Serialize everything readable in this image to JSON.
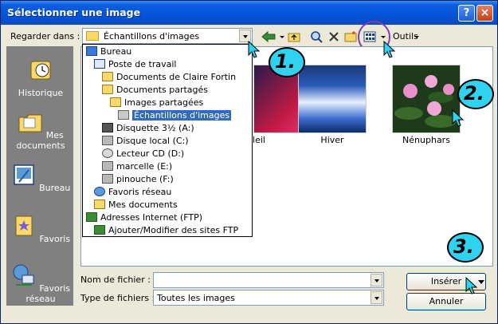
{
  "window": {
    "title": "Sélectionner une image",
    "help_label": "?",
    "close_label": "×"
  },
  "toolbar": {
    "look_in_label": "Regarder dans :",
    "look_in_value": "Échantillons d'images",
    "views_label": "Outils"
  },
  "places": [
    {
      "label": "Historique",
      "icon": "history-icon"
    },
    {
      "label": "Mes documents",
      "icon": "my-documents-icon"
    },
    {
      "label": "Bureau",
      "icon": "desktop-icon"
    },
    {
      "label": "Favoris",
      "icon": "favorites-icon"
    },
    {
      "label": "Favoris réseau",
      "icon": "network-places-icon"
    }
  ],
  "dropdown": {
    "items": [
      {
        "label": "Bureau",
        "icon": "desktop-icon",
        "indent": 0
      },
      {
        "label": "Poste de travail",
        "icon": "computer-icon",
        "indent": 1
      },
      {
        "label": "Documents de Claire Fortin",
        "icon": "folder-icon",
        "indent": 2
      },
      {
        "label": "Documents partagés",
        "icon": "folder-open-icon",
        "indent": 2
      },
      {
        "label": "Images partagées",
        "icon": "pictures-folder-icon",
        "indent": 3
      },
      {
        "label": "Échantillons d'images",
        "icon": "folder-icon",
        "indent": 4,
        "selected": true
      },
      {
        "label": "Disquette 3½ (A:)",
        "icon": "floppy-icon",
        "indent": 2
      },
      {
        "label": "Disque local (C:)",
        "icon": "drive-icon",
        "indent": 2
      },
      {
        "label": "Lecteur CD (D:)",
        "icon": "cd-icon",
        "indent": 2
      },
      {
        "label": "marcelle (E:)",
        "icon": "network-drive-icon",
        "indent": 2
      },
      {
        "label": "pinouche (F:)",
        "icon": "network-drive-icon",
        "indent": 2
      },
      {
        "label": "Favoris réseau",
        "icon": "network-places-icon",
        "indent": 1
      },
      {
        "label": "Mes documents",
        "icon": "my-documents-icon",
        "indent": 1
      },
      {
        "label": "Adresses Internet (FTP)",
        "icon": "ftp-icon",
        "indent": 0
      },
      {
        "label": "Ajouter/Modifier des sites FTP",
        "icon": "ftp-edit-icon",
        "indent": 1
      }
    ]
  },
  "thumbnails": [
    {
      "caption": "leil"
    },
    {
      "caption": "Hiver"
    },
    {
      "caption": "Nénuphars"
    }
  ],
  "filename": {
    "label": "Nom de fichier :",
    "value": ""
  },
  "filetype": {
    "label": "Type de fichiers :",
    "value": "Toutes les images"
  },
  "buttons": {
    "insert": "Insérer",
    "cancel": "Annuler"
  },
  "steps": [
    "1.",
    "2.",
    "3."
  ],
  "colors": {
    "title_bar": "#0654d8",
    "selection": "#316ac5",
    "places_bg": "#808080",
    "step_marker": "#2fd3ef"
  }
}
